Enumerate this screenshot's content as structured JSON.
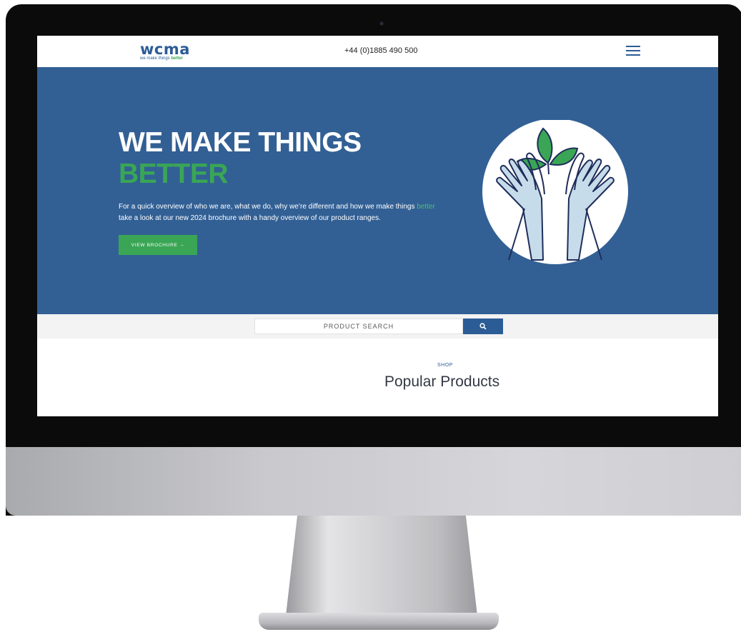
{
  "header": {
    "logo": {
      "word": "wcma",
      "tagline_prefix": "we make things",
      "tagline_accent": "better"
    },
    "phone": "+44 (0)1885 490 500",
    "menu_icon": "hamburger-menu-icon"
  },
  "hero": {
    "title_line1": "WE MAKE THINGS",
    "title_line2": "BETTER",
    "text_part1": "For a quick overview of who we are, what we do, why we’re different and how we make things ",
    "text_accent": "better",
    "text_part2": "take a look at our new 2024 brochure with a handy overview of our product ranges.",
    "button_label": "VIEW BROCHURE →",
    "illustration_icon": "hands-holding-leaf-icon"
  },
  "search": {
    "placeholder": "PRODUCT SEARCH",
    "button_icon": "search-icon"
  },
  "products": {
    "eyebrow": "SHOP",
    "title": "Popular Products"
  },
  "colors": {
    "brand_blue": "#326095",
    "dark_blue": "#2c5c96",
    "brand_green": "#3aa655",
    "navy_outline": "#1f2d5a"
  }
}
